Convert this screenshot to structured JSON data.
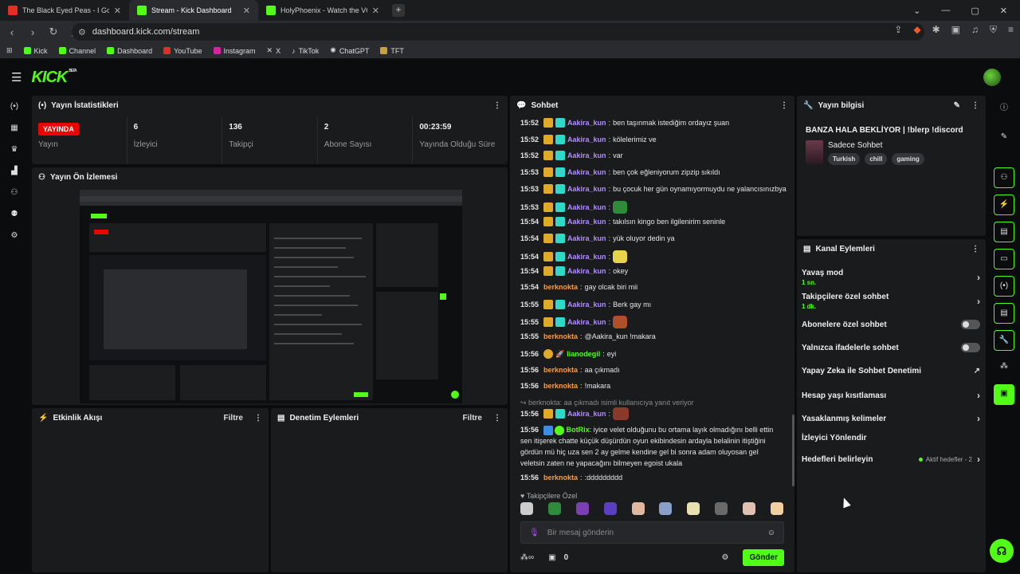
{
  "browser": {
    "tabs": [
      {
        "title": "The Black Eyed Peas - I Gotta Feeling",
        "icon": "youtube-icon",
        "color": "#e52d27"
      },
      {
        "title": "Stream - Kick Dashboard",
        "icon": "kick-icon",
        "color": "#53fc18"
      },
      {
        "title": "HolyPhoenix - Watch the VOD on Kick",
        "icon": "kick-icon",
        "color": "#53fc18"
      }
    ],
    "url": "dashboard.kick.com/stream",
    "bookmarks": [
      {
        "label": "Kick",
        "color": "#53fc18"
      },
      {
        "label": "Channel",
        "color": "#53fc18"
      },
      {
        "label": "Dashboard",
        "color": "#53fc18"
      },
      {
        "label": "YouTube",
        "color": "#e52d27"
      },
      {
        "label": "Instagram",
        "color": "#d6249f"
      },
      {
        "label": "X",
        "color": "#dddddd"
      },
      {
        "label": "TikTok",
        "color": "#dddddd"
      },
      {
        "label": "ChatGPT",
        "color": "#dddddd"
      },
      {
        "label": "TFT",
        "color": "#c8a040"
      }
    ]
  },
  "brand": {
    "logo": "KICK",
    "beta": "BETA",
    "accent": "#53fc18"
  },
  "stats_panel": {
    "title": "Yayın İstatistikleri",
    "live_badge": "YAYINDA",
    "items": [
      {
        "value": "",
        "label": "Yayın"
      },
      {
        "value": "6",
        "label": "İzleyici"
      },
      {
        "value": "136",
        "label": "Takipçi"
      },
      {
        "value": "2",
        "label": "Abone Sayısı"
      },
      {
        "value": "00:23:59",
        "label": "Yayında Olduğu Süre"
      }
    ]
  },
  "preview_panel": {
    "title": "Yayın Ön İzlemesi"
  },
  "activity_panel": {
    "title": "Etkinlik Akışı",
    "filter": "Filtre"
  },
  "moderation_panel": {
    "title": "Denetim Eylemleri",
    "filter": "Filtre"
  },
  "chat": {
    "title": "Sohbet",
    "messages": [
      {
        "time": "15:52",
        "user": "Aakira_kun",
        "style": "purple",
        "badges": true,
        "text": "ben taşınmak istediğim ordayız şuan"
      },
      {
        "time": "15:52",
        "user": "Aakira_kun",
        "style": "purple",
        "badges": true,
        "text": "kölelerimiz ve"
      },
      {
        "time": "15:52",
        "user": "Aakira_kun",
        "style": "purple",
        "badges": true,
        "text": "var"
      },
      {
        "time": "15:53",
        "user": "Aakira_kun",
        "style": "purple",
        "badges": true,
        "text": "ben çok eğleniyorum zipzip sıkıldı"
      },
      {
        "time": "15:53",
        "user": "Aakira_kun",
        "style": "purple",
        "badges": true,
        "text": "bu çocuk her gün oynamıyormuydu ne yalancısınızbya"
      },
      {
        "time": "15:53",
        "user": "Aakira_kun",
        "style": "purple",
        "badges": true,
        "text": "",
        "emote": "#2e8b3a"
      },
      {
        "time": "15:54",
        "user": "Aakira_kun",
        "style": "purple",
        "badges": true,
        "text": "takılsın kingo ben ilgilenirim seninle"
      },
      {
        "time": "15:54",
        "user": "Aakira_kun",
        "style": "purple",
        "badges": true,
        "text": "yük oluyor dedin ya"
      },
      {
        "time": "15:54",
        "user": "Aakira_kun",
        "style": "purple",
        "badges": true,
        "text": "",
        "emote": "#e8d44a"
      },
      {
        "time": "15:54",
        "user": "Aakira_kun",
        "style": "purple",
        "badges": true,
        "text": "okey"
      },
      {
        "time": "15:54",
        "user": "berknokta",
        "style": "orange",
        "badges": false,
        "text": "gay olcak biri mii"
      },
      {
        "time": "15:55",
        "user": "Aakira_kun",
        "style": "purple",
        "badges": true,
        "text": "Berk gay mı"
      },
      {
        "time": "15:55",
        "user": "Aakira_kun",
        "style": "purple",
        "badges": true,
        "text": "",
        "emote": "#b0502a"
      },
      {
        "time": "15:55",
        "user": "berknokta",
        "style": "orange",
        "badges": false,
        "text": "@Aakira_kun !makara"
      },
      {
        "time": "15:56",
        "user": "lianodegil",
        "style": "green",
        "badges": false,
        "text": "eyi"
      },
      {
        "time": "15:56",
        "user": "berknokta",
        "style": "orange",
        "badges": false,
        "text": "aa çıkmadı"
      },
      {
        "time": "15:56",
        "user": "berknokta",
        "style": "orange",
        "badges": false,
        "text": "!makara"
      }
    ],
    "reply_note": "berknokta: aa çıkmadı isimli kullanıcıya yanıt veriyor",
    "reply_msg": {
      "time": "15:56",
      "user": "Aakira_kun"
    },
    "bot_msg": {
      "time": "15:56",
      "user": "BotRix",
      "text": "iyice velet olduğunu bu ortama layık olmadığını belli ettin sen itişerek chatte küçük düşürdün oyun ekibindesin ardayla belalinin itiştiğini gördün mü hiç uza sen 2 ay gelme kendine gel bi sonra adam oluyosan gel veletsin zaten ne yapacağını bilmeyen egoist ukala"
    },
    "last_msg": {
      "time": "15:56",
      "user": "berknokta",
      "text": ":ddddddddd"
    },
    "pinned_label": "Takipçilere Özel",
    "input_placeholder": "Bir mesaj gönderin",
    "points": "0",
    "send_label": "Gönder"
  },
  "info_panel": {
    "title": "Yayın bilgisi",
    "stream_title": "BANZA HALA BEKLİYOR | !blerp !discord",
    "category": "Sadece Sohbet",
    "tags": [
      "Turkish",
      "chill",
      "gaming"
    ]
  },
  "actions_panel": {
    "title": "Kanal Eylemleri",
    "items": [
      {
        "label": "Yavaş mod",
        "sub": "1 sn.",
        "control": "chevron"
      },
      {
        "label": "Takipçilere özel sohbet",
        "sub": "1 dk.",
        "control": "chevron"
      },
      {
        "label": "Abonelere özel sohbet",
        "sub": "",
        "control": "toggle"
      },
      {
        "label": "Yalnızca ifadelerle sohbet",
        "sub": "",
        "control": "toggle"
      },
      {
        "label": "Yapay Zeka ile Sohbet Denetimi",
        "sub": "",
        "control": "external"
      },
      {
        "label": "Hesap yaşı kısıtlaması",
        "sub": "",
        "control": "chevron"
      },
      {
        "label": "Yasaklanmış kelimeler",
        "sub": "",
        "control": "chevron"
      },
      {
        "label": "İzleyici Yönlendir",
        "sub": "",
        "control": "none"
      },
      {
        "label": "Hedefleri belirleyin",
        "sub": "",
        "control": "goals",
        "goals": "Aktif hedefler - 2"
      }
    ]
  }
}
